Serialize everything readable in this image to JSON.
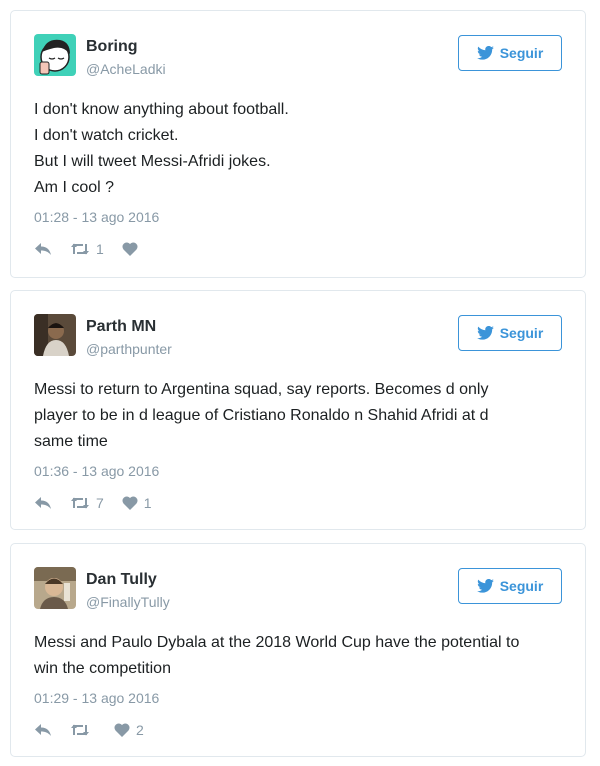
{
  "follow_label": "Seguir",
  "colors": {
    "accent": "#3b94d9",
    "muted": "#8899a6",
    "border": "#e1e8ed"
  },
  "tweets": [
    {
      "name": "Boring",
      "handle": "@AcheLadki",
      "lines": [
        "I don't know anything about football.",
        "I don't watch cricket.",
        "But I will tweet Messi-Afridi jokes.",
        "Am I cool ?"
      ],
      "time": "01:28 - 13 ago 2016",
      "retweets": "1",
      "likes": ""
    },
    {
      "name": "Parth MN",
      "handle": "@parthpunter",
      "lines": [
        "Messi to return to Argentina squad, say reports. Becomes d only",
        "player to be in d league of Cristiano Ronaldo n Shahid Afridi at d",
        "same time"
      ],
      "time": "01:36 - 13 ago 2016",
      "retweets": "7",
      "likes": "1"
    },
    {
      "name": "Dan Tully",
      "handle": "@FinallyTully",
      "lines": [
        "Messi and Paulo Dybala at the 2018 World Cup have the potential to",
        "win the competition"
      ],
      "time": "01:29 - 13 ago 2016",
      "retweets": "",
      "likes": "2"
    }
  ]
}
